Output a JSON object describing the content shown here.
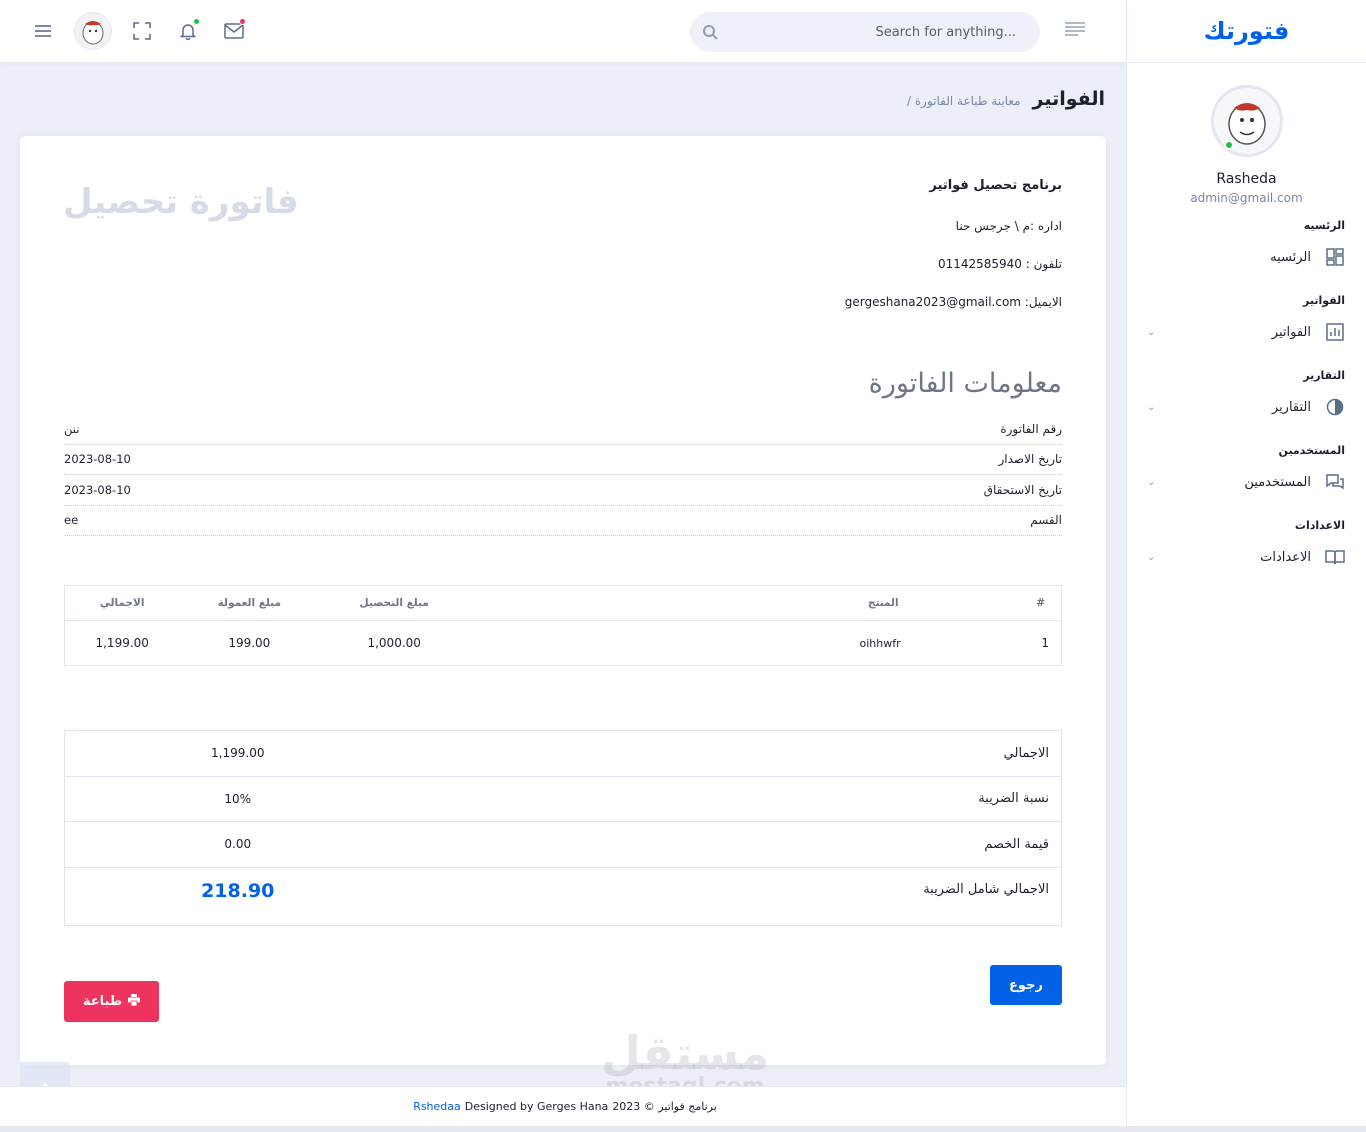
{
  "brand": "فتورتك",
  "colors": {
    "primary": "#0162e8",
    "danger": "#ee335e",
    "online": "#22c03c",
    "notification_dot": "#22c03c",
    "mail_dot": "#ee335e"
  },
  "header": {
    "search_placeholder": "Search for anything...",
    "icons": [
      "menu-icon",
      "avatar",
      "fullscreen-icon",
      "bell-icon",
      "mail-icon",
      "search-icon",
      "right-menu-icon"
    ]
  },
  "sidebar": {
    "user_name": "Rasheda",
    "user_email": "admin@gmail.com",
    "sections": [
      {
        "category": "الرئسيه",
        "label": "الرئسيه",
        "icon": "dashboard-icon",
        "has_submenu": false
      },
      {
        "category": "الفواتير",
        "label": "الفواتير",
        "icon": "bar-chart-icon",
        "has_submenu": true
      },
      {
        "category": "التقارير",
        "label": "التقارير",
        "icon": "pie-chart-icon",
        "has_submenu": true
      },
      {
        "category": "المستخدمين",
        "label": "المستخدمين",
        "icon": "chat-icon",
        "has_submenu": true
      },
      {
        "category": "الاعدادات",
        "label": "الاعدادات",
        "icon": "book-icon",
        "has_submenu": true
      }
    ]
  },
  "page": {
    "title": "الفواتير",
    "breadcrumb": "/ معاينة طباعة الفاتورة"
  },
  "invoice": {
    "heading": "فاتورة تحصيل",
    "company_name": "برنامج تحصيل فواتير",
    "management": "اداره :م \\ جرجس حنا",
    "phone": "تلفون : 01142585940",
    "email": "الايميل: gergeshana2023@gmail.com",
    "info_title": "معلومات الفاتورة",
    "info_rows": [
      {
        "label": "رقم الفاتورة",
        "value": "ننن"
      },
      {
        "label": "تاريخ الاصدار",
        "value": "2023-08-10"
      },
      {
        "label": "تاريخ الاستحقاق",
        "value": "2023-08-10"
      },
      {
        "label": "القسم",
        "value": "ee"
      }
    ],
    "items_headers": [
      "#",
      "المنتج",
      "مبلغ التحصيل",
      "مبلغ العمولة",
      "الاجمالي"
    ],
    "items": [
      {
        "num": "1",
        "product": "oihhwfr",
        "collection": "1,000.00",
        "commission": "199.00",
        "total": "1,199.00"
      }
    ],
    "totals": [
      {
        "label": "الاجمالي",
        "value": "1,199.00"
      },
      {
        "label": "نسبة الضريبة",
        "value": "10%"
      },
      {
        "label": "قيمة الخصم",
        "value": "0.00"
      }
    ],
    "grand_total_label": "الاجمالي شامل الضريبة",
    "grand_total_value": "218.90",
    "back_label": "رجوع",
    "print_label": "طباعة"
  },
  "footer": {
    "prefix": "برنامج فواتير © 2023",
    "middle": "Designed by Gerges Hana",
    "credit": "Rshedaa"
  },
  "watermark": {
    "line1": "مستقل",
    "line2": "mostaql.com"
  }
}
